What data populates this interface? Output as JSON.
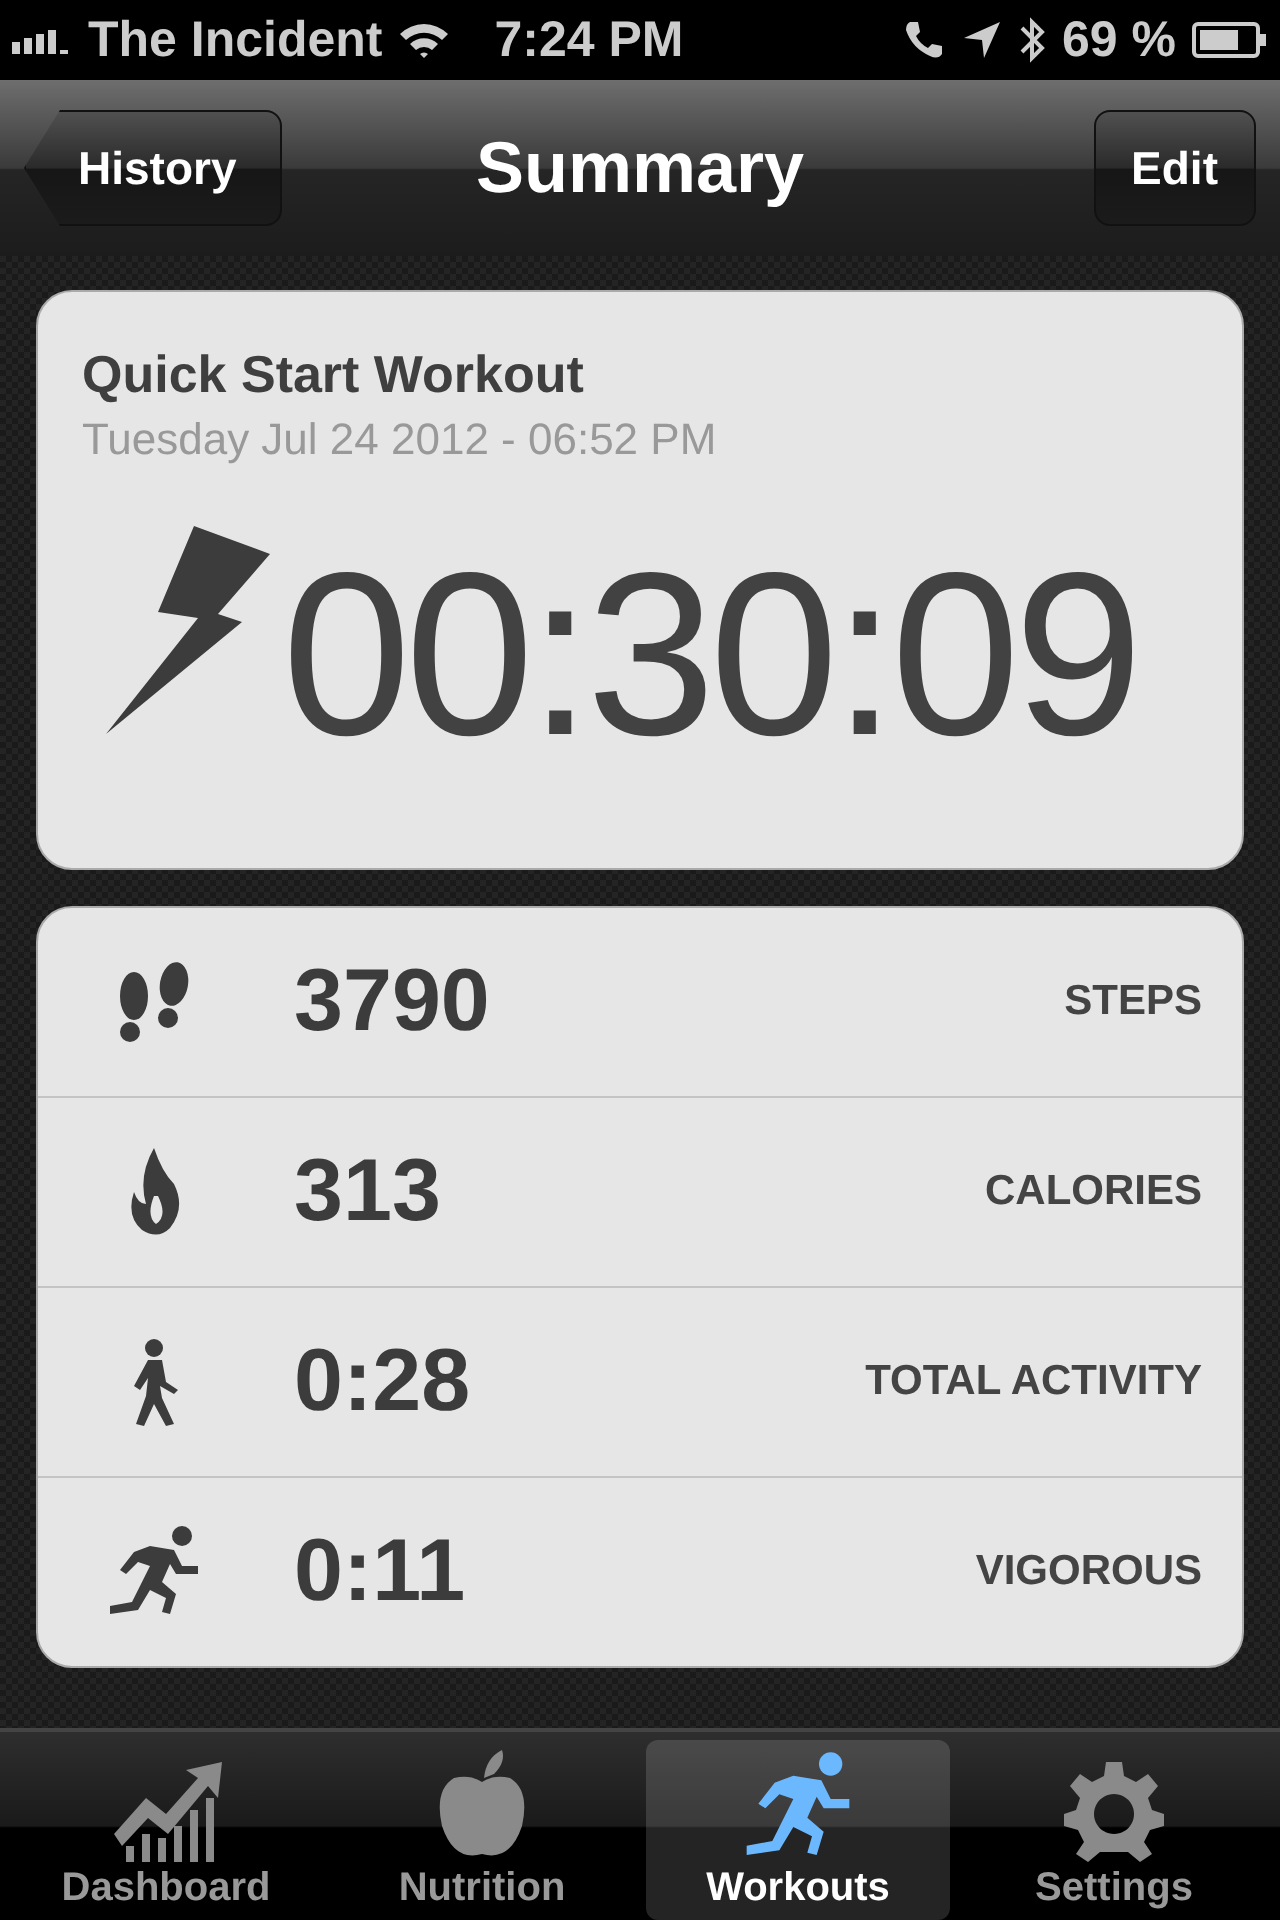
{
  "status_bar": {
    "carrier": "The Incident",
    "time": "7:24 PM",
    "battery": "69 %"
  },
  "nav_bar": {
    "back_button": "History",
    "title": "Summary",
    "edit_button": "Edit"
  },
  "workout": {
    "title": "Quick Start Workout",
    "date": "Tuesday Jul 24 2012 - 06:52 PM",
    "duration": "00:30:09"
  },
  "stats": [
    {
      "kind": "steps",
      "value": "3790",
      "label": "STEPS"
    },
    {
      "kind": "calories",
      "value": "313",
      "label": "CALORIES"
    },
    {
      "kind": "activity",
      "value": "0:28",
      "label": "TOTAL ACTIVITY"
    },
    {
      "kind": "vigorous",
      "value": "0:11",
      "label": "VIGOROUS"
    }
  ],
  "tab_bar": [
    {
      "kind": "dashboard",
      "label": "Dashboard",
      "selected": false
    },
    {
      "kind": "nutrition",
      "label": "Nutrition",
      "selected": false
    },
    {
      "kind": "workouts",
      "label": "Workouts",
      "selected": true
    },
    {
      "kind": "settings",
      "label": "Settings",
      "selected": false
    }
  ]
}
